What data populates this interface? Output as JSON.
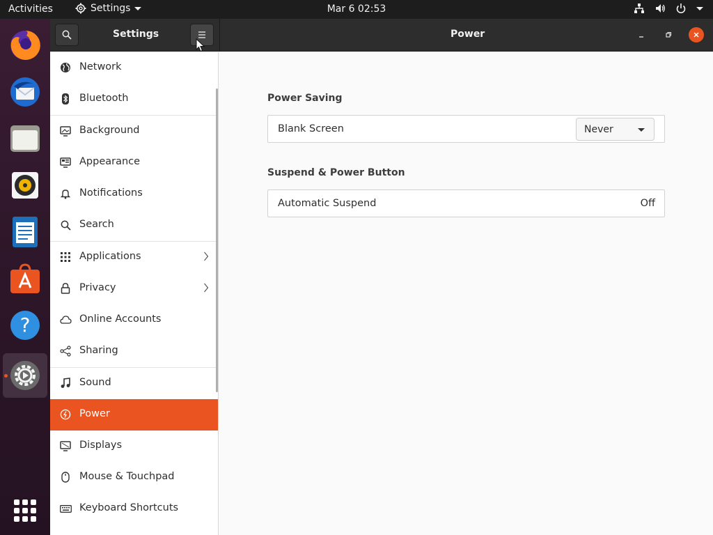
{
  "topbar": {
    "activities": "Activities",
    "app_menu": "Settings",
    "clock": "Mar 6  02:53"
  },
  "window": {
    "sidebar_title": "Settings",
    "page_title": "Power"
  },
  "sidebar": {
    "items": [
      {
        "label": "Network",
        "icon": "globe-icon"
      },
      {
        "label": "Bluetooth",
        "icon": "bluetooth-icon"
      },
      {
        "label": "Background",
        "icon": "monitor-icon"
      },
      {
        "label": "Appearance",
        "icon": "appearance-icon"
      },
      {
        "label": "Notifications",
        "icon": "bell-icon"
      },
      {
        "label": "Search",
        "icon": "search-icon"
      },
      {
        "label": "Applications",
        "icon": "apps-grid-icon"
      },
      {
        "label": "Privacy",
        "icon": "lock-icon"
      },
      {
        "label": "Online Accounts",
        "icon": "cloud-icon"
      },
      {
        "label": "Sharing",
        "icon": "share-icon"
      },
      {
        "label": "Sound",
        "icon": "music-note-icon"
      },
      {
        "label": "Power",
        "icon": "power-icon"
      },
      {
        "label": "Displays",
        "icon": "display-icon"
      },
      {
        "label": "Mouse & Touchpad",
        "icon": "mouse-icon"
      },
      {
        "label": "Keyboard Shortcuts",
        "icon": "keyboard-icon"
      }
    ],
    "selected": "Power"
  },
  "power": {
    "power_saving": {
      "title": "Power Saving",
      "blank_screen_label": "Blank Screen",
      "blank_screen_value": "Never"
    },
    "suspend": {
      "title": "Suspend & Power Button",
      "automatic_suspend_label": "Automatic Suspend",
      "automatic_suspend_value": "Off"
    }
  },
  "colors": {
    "accent": "#e95420",
    "headerbar": "#2d2d2d",
    "topbar": "#1d1d1d"
  }
}
